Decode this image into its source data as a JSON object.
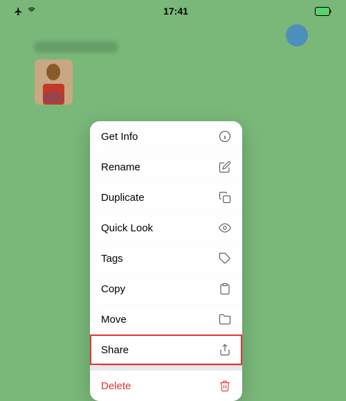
{
  "statusBar": {
    "time": "17:41",
    "icons": {
      "airplane": "✈",
      "wifi": "wifi",
      "battery": "battery"
    }
  },
  "contextMenu": {
    "items": [
      {
        "id": "get-info",
        "label": "Get Info",
        "icon": "info"
      },
      {
        "id": "rename",
        "label": "Rename",
        "icon": "pencil"
      },
      {
        "id": "duplicate",
        "label": "Duplicate",
        "icon": "duplicate"
      },
      {
        "id": "quick-look",
        "label": "Quick Look",
        "icon": "eye"
      },
      {
        "id": "tags",
        "label": "Tags",
        "icon": "tag"
      },
      {
        "id": "copy",
        "label": "Copy",
        "icon": "copy"
      },
      {
        "id": "move",
        "label": "Move",
        "icon": "folder"
      },
      {
        "id": "share",
        "label": "Share",
        "icon": "share",
        "highlighted": true
      },
      {
        "id": "delete",
        "label": "Delete",
        "icon": "trash",
        "destructive": true
      }
    ]
  }
}
